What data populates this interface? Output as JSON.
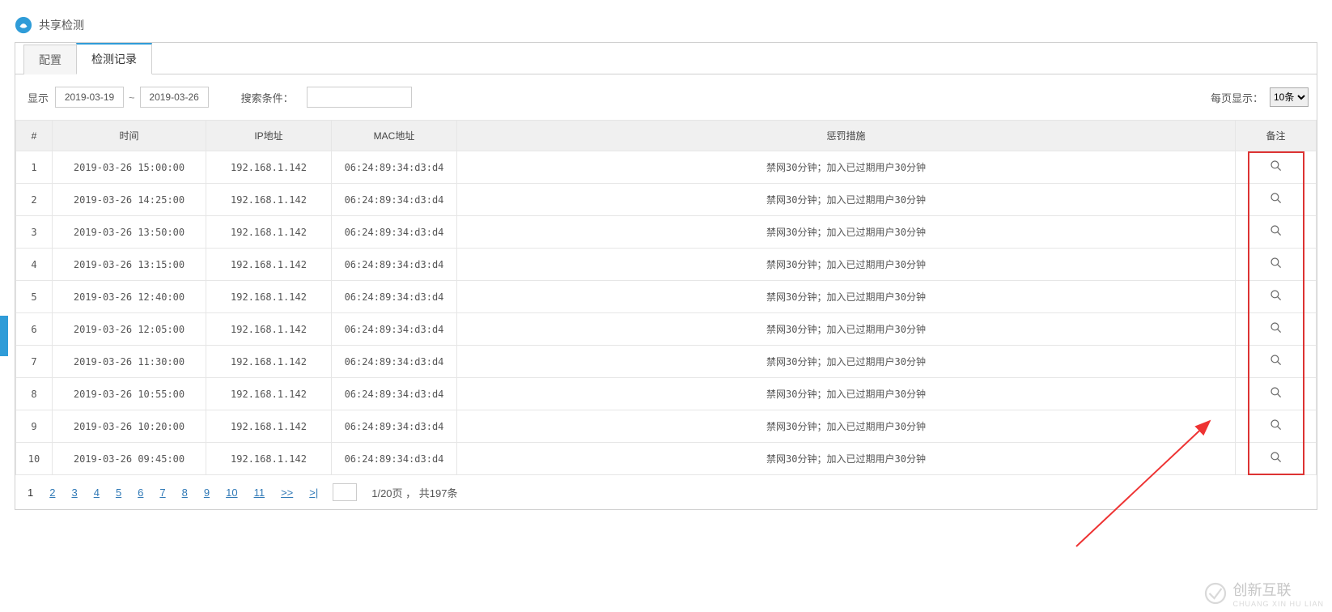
{
  "header": {
    "title": "共享检测"
  },
  "tabs": [
    {
      "label": "配置",
      "active": false
    },
    {
      "label": "检测记录",
      "active": true
    }
  ],
  "toolbar": {
    "show_label": "显示",
    "date_from": "2019-03-19",
    "date_sep": "~",
    "date_to": "2019-03-26",
    "search_label": "搜索条件：",
    "search_value": "",
    "perpage_label": "每页显示：",
    "perpage_options": [
      "10条"
    ],
    "perpage_selected": "10条"
  },
  "table": {
    "headers": {
      "num": "#",
      "time": "时间",
      "ip": "IP地址",
      "mac": "MAC地址",
      "punish": "惩罚措施",
      "remark": "备注"
    },
    "rows": [
      {
        "n": "1",
        "time": "2019-03-26 15:00:00",
        "ip": "192.168.1.142",
        "mac": "06:24:89:34:d3:d4",
        "punish": "禁网30分钟；加入已过期用户30分钟"
      },
      {
        "n": "2",
        "time": "2019-03-26 14:25:00",
        "ip": "192.168.1.142",
        "mac": "06:24:89:34:d3:d4",
        "punish": "禁网30分钟；加入已过期用户30分钟"
      },
      {
        "n": "3",
        "time": "2019-03-26 13:50:00",
        "ip": "192.168.1.142",
        "mac": "06:24:89:34:d3:d4",
        "punish": "禁网30分钟；加入已过期用户30分钟"
      },
      {
        "n": "4",
        "time": "2019-03-26 13:15:00",
        "ip": "192.168.1.142",
        "mac": "06:24:89:34:d3:d4",
        "punish": "禁网30分钟；加入已过期用户30分钟"
      },
      {
        "n": "5",
        "time": "2019-03-26 12:40:00",
        "ip": "192.168.1.142",
        "mac": "06:24:89:34:d3:d4",
        "punish": "禁网30分钟；加入已过期用户30分钟"
      },
      {
        "n": "6",
        "time": "2019-03-26 12:05:00",
        "ip": "192.168.1.142",
        "mac": "06:24:89:34:d3:d4",
        "punish": "禁网30分钟；加入已过期用户30分钟"
      },
      {
        "n": "7",
        "time": "2019-03-26 11:30:00",
        "ip": "192.168.1.142",
        "mac": "06:24:89:34:d3:d4",
        "punish": "禁网30分钟；加入已过期用户30分钟"
      },
      {
        "n": "8",
        "time": "2019-03-26 10:55:00",
        "ip": "192.168.1.142",
        "mac": "06:24:89:34:d3:d4",
        "punish": "禁网30分钟；加入已过期用户30分钟"
      },
      {
        "n": "9",
        "time": "2019-03-26 10:20:00",
        "ip": "192.168.1.142",
        "mac": "06:24:89:34:d3:d4",
        "punish": "禁网30分钟；加入已过期用户30分钟"
      },
      {
        "n": "10",
        "time": "2019-03-26 09:45:00",
        "ip": "192.168.1.142",
        "mac": "06:24:89:34:d3:d4",
        "punish": "禁网30分钟；加入已过期用户30分钟"
      }
    ]
  },
  "pagination": {
    "current": "1",
    "links": [
      "2",
      "3",
      "4",
      "5",
      "6",
      "7",
      "8",
      "9",
      "10",
      "11"
    ],
    "next_icon": ">>",
    "last_icon": ">|",
    "page_input": "",
    "info": "1/20页 ， 共197条"
  },
  "watermark": {
    "text": "创新互联",
    "sub": "CHUANG XIN HU LIAN"
  }
}
